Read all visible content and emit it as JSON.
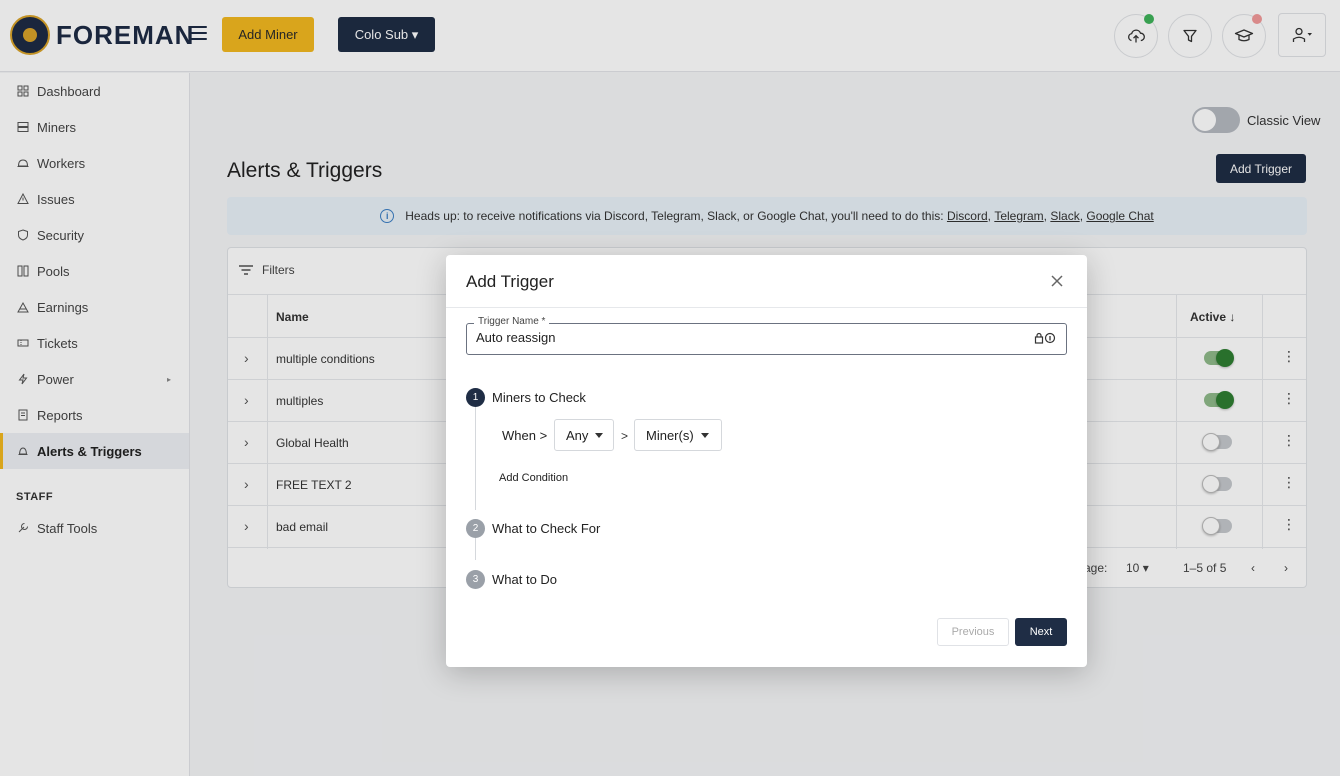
{
  "brand": {
    "name": "FOREMAN"
  },
  "header": {
    "add_miner_label": "Add Miner",
    "colo_label": "Colo Sub",
    "upload_status_color": "#3fb35a",
    "learn_status_color": "#f29a9a"
  },
  "sidebar": {
    "items": [
      {
        "label": "Dashboard",
        "icon": "dashboard-icon"
      },
      {
        "label": "Miners",
        "icon": "miners-icon"
      },
      {
        "label": "Workers",
        "icon": "workers-icon"
      },
      {
        "label": "Issues",
        "icon": "warning-icon"
      },
      {
        "label": "Security",
        "icon": "shield-icon"
      },
      {
        "label": "Pools",
        "icon": "pools-icon"
      },
      {
        "label": "Earnings",
        "icon": "earnings-icon"
      },
      {
        "label": "Tickets",
        "icon": "ticket-icon"
      },
      {
        "label": "Power",
        "icon": "bolt-icon"
      },
      {
        "label": "Reports",
        "icon": "reports-icon"
      },
      {
        "label": "Alerts & Triggers",
        "icon": "bell-icon"
      }
    ],
    "staff_heading": "STAFF",
    "staff_tools_label": "Staff Tools"
  },
  "main": {
    "classic_view_label": "Classic View",
    "title": "Alerts & Triggers",
    "add_trigger_label": "Add Trigger",
    "banner": {
      "text": "Heads up: to receive notifications via Discord, Telegram, Slack, or Google Chat, you'll need to do this:",
      "links": [
        "Discord",
        "Telegram",
        "Slack",
        "Google Chat"
      ]
    },
    "filters_label": "Filters",
    "table": {
      "columns": {
        "name": "Name",
        "active": "Active"
      },
      "rows": [
        {
          "name": "multiple conditions",
          "active": true
        },
        {
          "name": "multiples",
          "active": true
        },
        {
          "name": "Global Health",
          "active": false
        },
        {
          "name": "FREE TEXT 2",
          "active": false
        },
        {
          "name": "bad email",
          "active": false
        }
      ]
    },
    "pagination": {
      "rows_label_fragment": "age:",
      "rows_per_page": "10",
      "range": "1–5 of 5"
    }
  },
  "modal": {
    "title": "Add Trigger",
    "field_label": "Trigger Name *",
    "field_value": "Auto reassign",
    "steps": [
      {
        "number": "1",
        "label": "Miners to Check"
      },
      {
        "number": "2",
        "label": "What to Check For"
      },
      {
        "number": "3",
        "label": "What to Do"
      }
    ],
    "when_label": "When >",
    "any_value": "Any",
    "gt_separator": ">",
    "miners_value": "Miner(s)",
    "add_condition_label": "Add Condition",
    "previous_label": "Previous",
    "next_label": "Next",
    "step_active_color": "#1f2d45",
    "step_inactive_color": "#9aa0a8"
  }
}
